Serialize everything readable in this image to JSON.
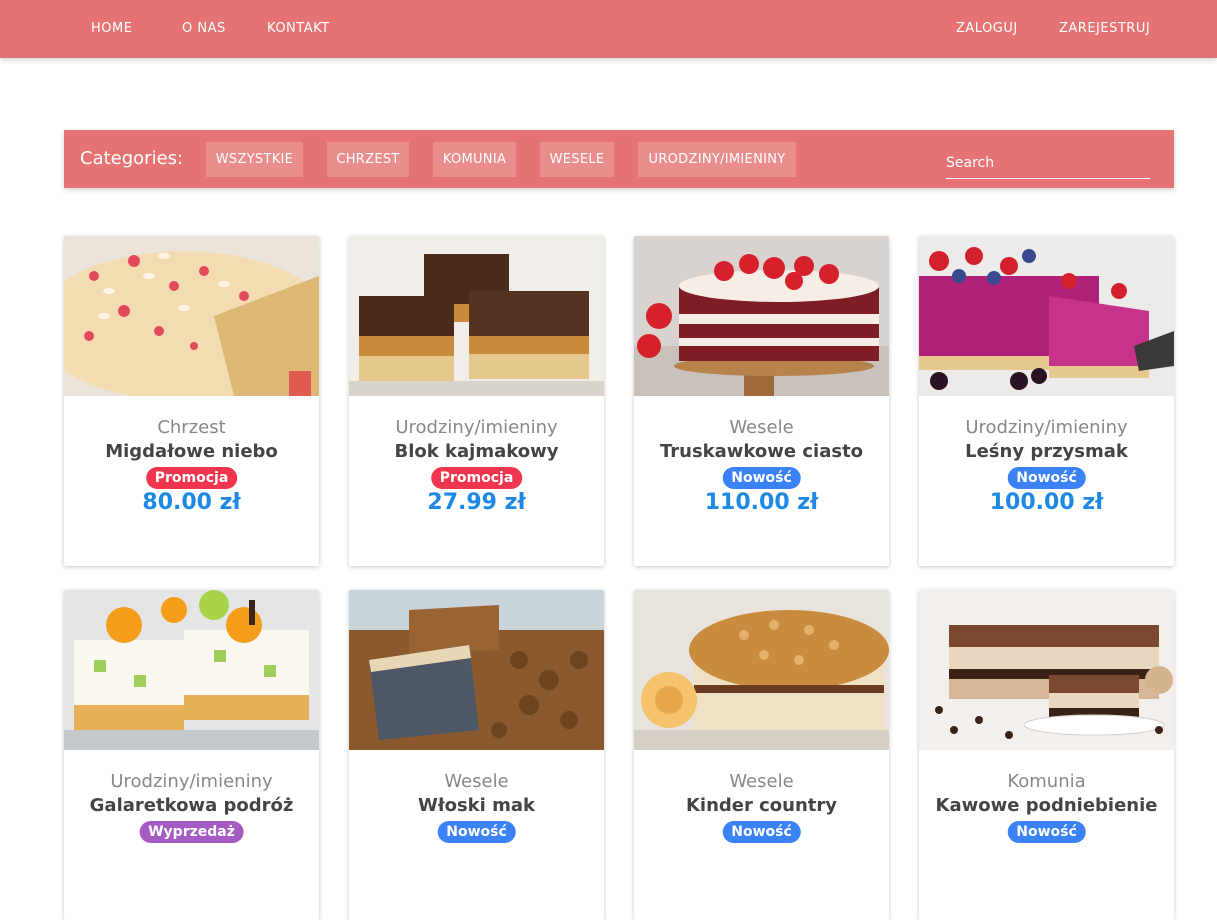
{
  "nav": {
    "left": [
      "HOME",
      "O NAS",
      "KONTAKT"
    ],
    "right": [
      "ZALOGUJ",
      "ZAREJESTRUJ"
    ]
  },
  "categories": {
    "label": "Categories:",
    "items": [
      "WSZYSTKIE",
      "CHRZEST",
      "KOMUNIA",
      "WESELE",
      "URODZINY/IMIENINY"
    ],
    "search_placeholder": "Search"
  },
  "colors": {
    "brand": "#e57373",
    "price": "#1e88e5",
    "promo": "#f0364f",
    "new": "#3b82f6",
    "sale": "#a55bc4"
  },
  "products": [
    {
      "category": "Chrzest",
      "name": "Migdałowe niebo",
      "badge": "Promocja",
      "badge_type": "promo",
      "price": "80.00 zł",
      "image": "almond-strawberry-cake"
    },
    {
      "category": "Urodziny/imieniny",
      "name": "Blok kajmakowy",
      "badge": "Promocja",
      "badge_type": "promo",
      "price": "27.99 zł",
      "image": "caramel-chocolate-bars"
    },
    {
      "category": "Wesele",
      "name": "Truskawkowe ciasto",
      "badge": "Nowość",
      "badge_type": "new",
      "price": "110.00 zł",
      "image": "red-velvet-strawberry-cake"
    },
    {
      "category": "Urodziny/imieniny",
      "name": "Leśny przysmak",
      "badge": "Nowość",
      "badge_type": "new",
      "price": "100.00 zł",
      "image": "berry-mousse-cake"
    },
    {
      "category": "Urodziny/imieniny",
      "name": "Galaretkowa podróż",
      "badge": "Wyprzedaż",
      "badge_type": "sale",
      "price": "",
      "image": "jelly-fruit-cake"
    },
    {
      "category": "Wesele",
      "name": "Włoski mak",
      "badge": "Nowość",
      "badge_type": "new",
      "price": "",
      "image": "poppyseed-walnut-cake"
    },
    {
      "category": "Wesele",
      "name": "Kinder country",
      "badge": "Nowość",
      "badge_type": "new",
      "price": "",
      "image": "nut-crunch-cake"
    },
    {
      "category": "Komunia",
      "name": "Kawowe podniebienie",
      "badge": "Nowość",
      "badge_type": "new",
      "price": "",
      "image": "coffee-layer-cake"
    }
  ]
}
